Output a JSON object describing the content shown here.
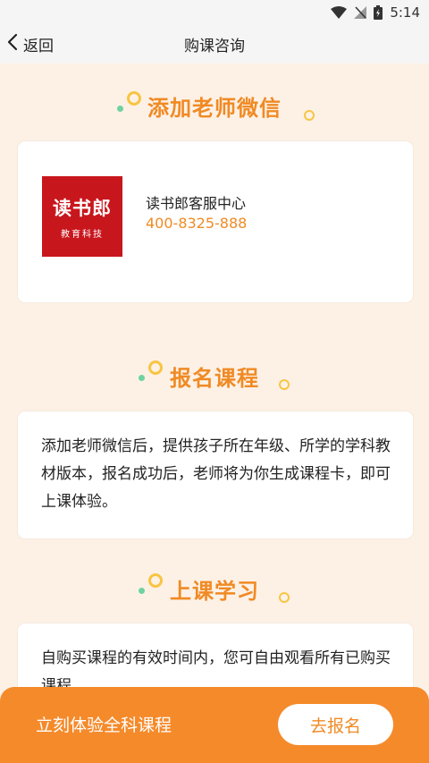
{
  "status_bar": {
    "time": "5:14"
  },
  "nav": {
    "back_label": "返回",
    "title": "购课咨询"
  },
  "section_wechat": {
    "title": "添加老师微信",
    "logo_main": "读书郎",
    "logo_sub": "教育科技",
    "contact_name": "读书郎客服中心",
    "contact_phone": "400-8325-888"
  },
  "section_signup": {
    "title": "报名课程",
    "text": "添加老师微信后，提供孩子所在年级、所学的学科教材版本，报名成功后，老师将为你生成课程卡，即可上课体验。"
  },
  "section_study": {
    "title": "上课学习",
    "text": "自购买课程的有效时间内，您可自由观看所有已购买课程。"
  },
  "bottom": {
    "promo": "立刻体验全科课程",
    "button": "去报名"
  },
  "colors": {
    "accent": "#f08a24",
    "bar": "#f58a2a",
    "logo_bg": "#c8161d",
    "bg": "#fdf1e6"
  }
}
